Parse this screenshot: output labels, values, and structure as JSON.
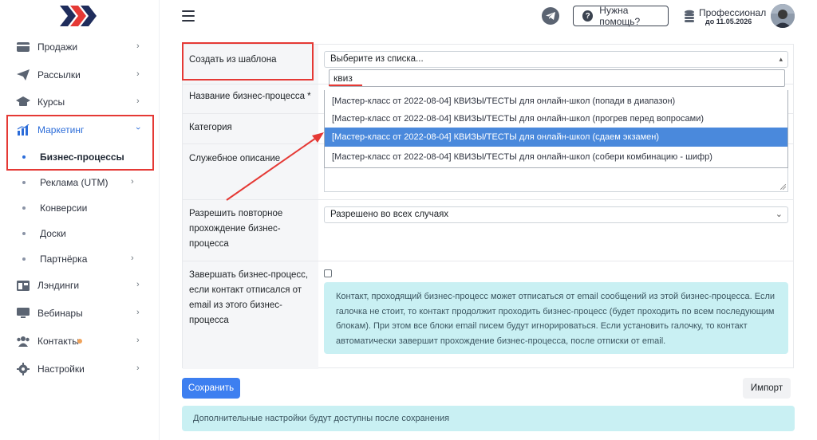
{
  "sidebar": {
    "items": [
      {
        "label": "Продажи",
        "icon": "card-icon"
      },
      {
        "label": "Рассылки",
        "icon": "paper-plane-icon"
      },
      {
        "label": "Курсы",
        "icon": "graduation-cap-icon"
      },
      {
        "label": "Маркетинг",
        "icon": "chart-bar-icon"
      },
      {
        "label": "Лэндинги",
        "icon": "layout-icon"
      },
      {
        "label": "Вебинары",
        "icon": "monitor-icon"
      },
      {
        "label": "Контакты",
        "icon": "users-icon"
      },
      {
        "label": "Настройки",
        "icon": "gear-icon"
      }
    ],
    "sub_items": [
      {
        "label": "Бизнес-процессы"
      },
      {
        "label": "Реклама (UTM)"
      },
      {
        "label": "Конверсии"
      },
      {
        "label": "Доски"
      },
      {
        "label": "Партнёрка"
      }
    ]
  },
  "header": {
    "help_label": "Нужна помощь?",
    "plan_name": "Профессионал",
    "plan_date": "до 11.05.2026"
  },
  "form": {
    "template_label": "Создать из шаблона",
    "template_select_value": "Выберите из списка...",
    "search_value": "квиз",
    "options": [
      "[Мастер-класс от 2022-08-04] КВИЗЫ/ТЕСТЫ для онлайн-школ (попади в диапазон)",
      "[Мастер-класс от 2022-08-04] КВИЗЫ/ТЕСТЫ для онлайн-школ (прогрев перед вопросами)",
      "[Мастер-класс от 2022-08-04] КВИЗЫ/ТЕСТЫ для онлайн-школ (сдаем экзамен)",
      "[Мастер-класс от 2022-08-04] КВИЗЫ/ТЕСТЫ для онлайн-школ (собери комбинацию - шифр)"
    ],
    "name_label": "Название бизнес-процесса *",
    "category_label": "Категория",
    "description_label": "Служебное описание",
    "repeat_label_1": "Разрешить повторное",
    "repeat_label_2": "прохождение бизнес-",
    "repeat_label_3": "процесса",
    "repeat_select_value": "Разрешено во всех случаях",
    "finish_label_1": "Завершать бизнес-процесс,",
    "finish_label_2": "если контакт отписался от",
    "finish_label_3": "email из этого бизнес-",
    "finish_label_4": "процесса",
    "info_line_1": "Контакт, проходящий бизнес-процесс может отписаться от email сообщений из этой бизнес-процесса. Если",
    "info_line_2": "галочка не стоит, то контакт продолжит проходить бизнес-процесс (будет проходить по всем последующим",
    "info_line_3": "блокам). При этом все блоки email писем будут игнорироваться. Если установить галочку, то контакт",
    "info_line_4": "автоматически завершит прохождение бизнес-процесса, после отписки от email."
  },
  "actions": {
    "save_label": "Сохранить",
    "import_label": "Импорт",
    "note": "Дополнительные настройки будут доступны после сохранения"
  },
  "colors": {
    "accent": "#3d7ff0",
    "highlight": "#4a89dc",
    "annotation": "#e53935",
    "info_bg": "#c9f0f3"
  }
}
